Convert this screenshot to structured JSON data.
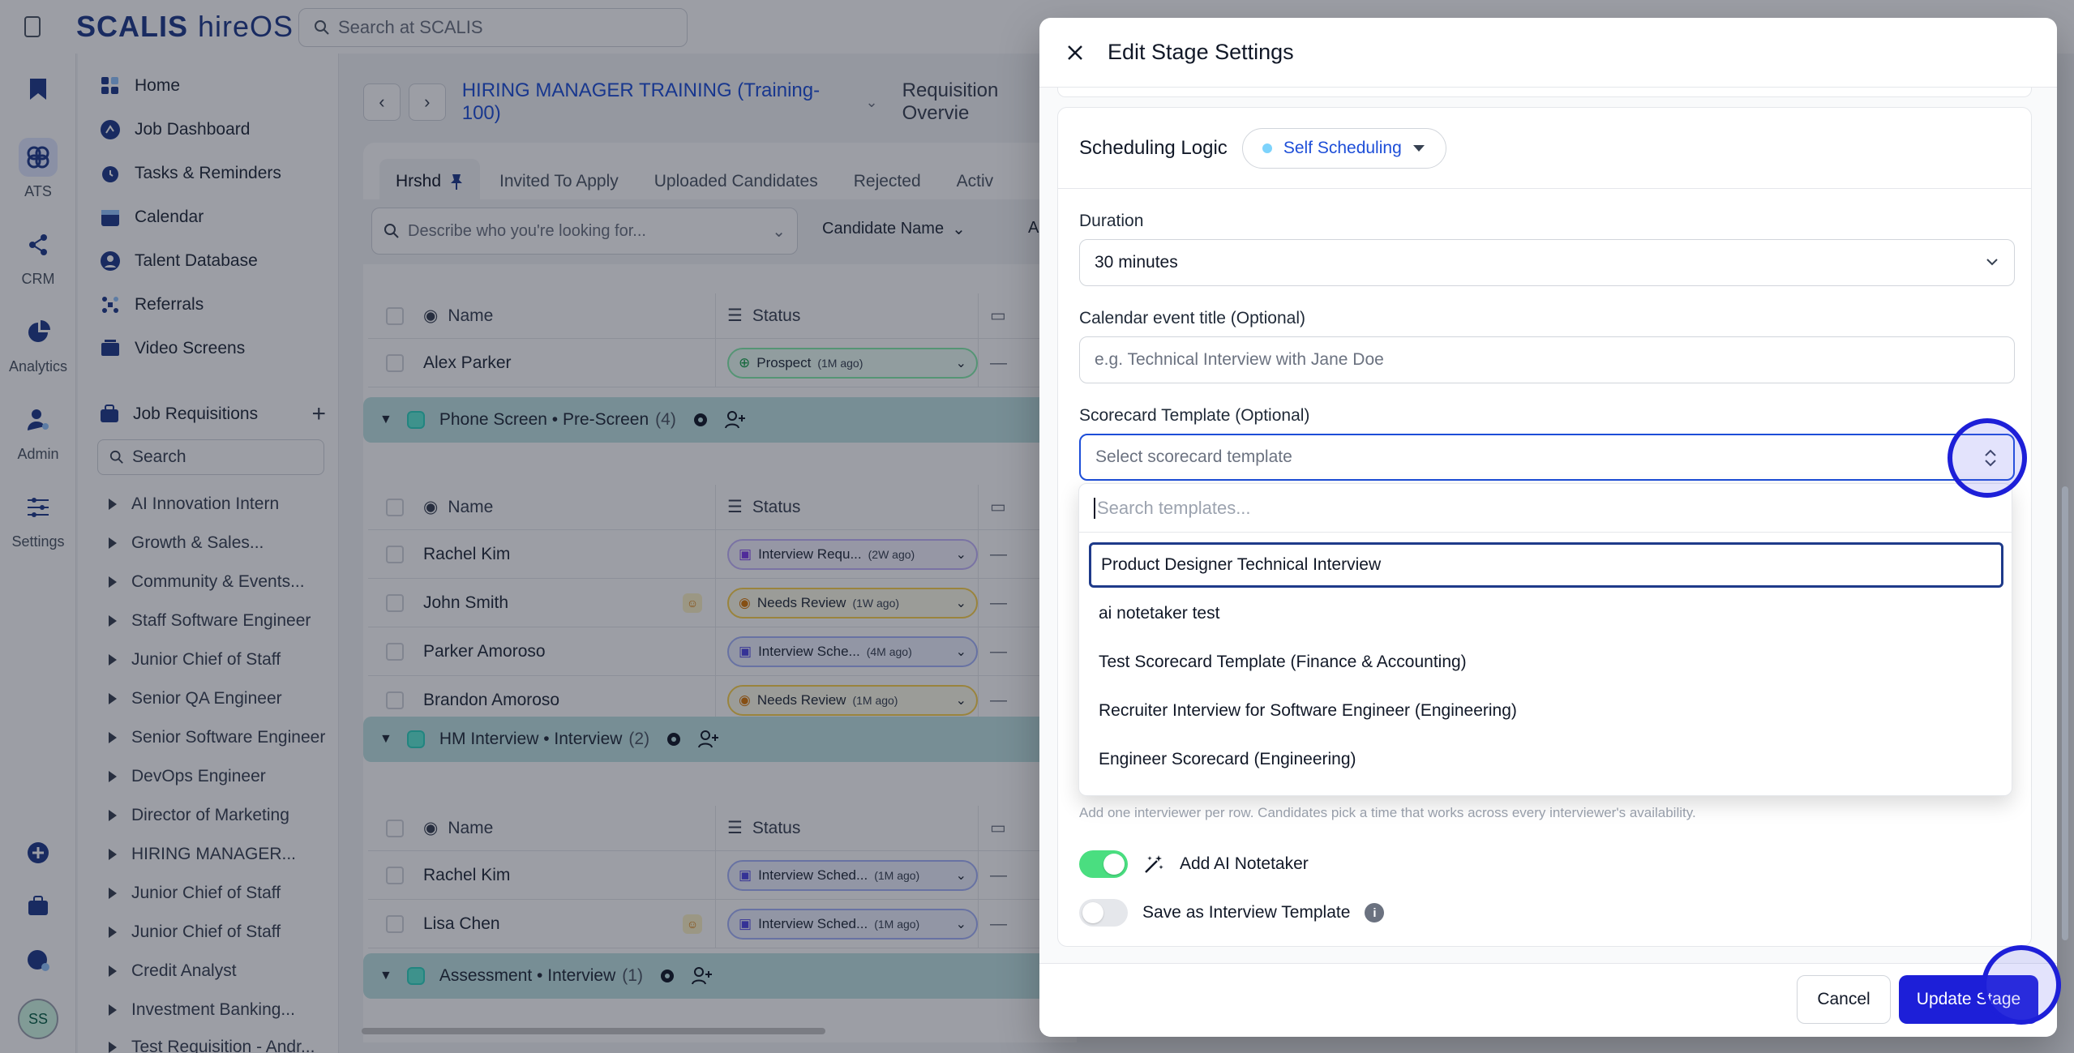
{
  "app": {
    "brand": "SCALIS",
    "product": "hireOS",
    "search_placeholder": "Search at SCALIS"
  },
  "rail": {
    "items": [
      {
        "label": "ATS",
        "icon": "ats-icon"
      },
      {
        "label": "CRM",
        "icon": "crm-icon"
      },
      {
        "label": "Analytics",
        "icon": "analytics-icon"
      },
      {
        "label": "Admin",
        "icon": "admin-icon"
      },
      {
        "label": "Settings",
        "icon": "settings-icon"
      }
    ],
    "avatar_initials": "SS"
  },
  "sidebar": {
    "nav": [
      "Home",
      "Job Dashboard",
      "Tasks & Reminders",
      "Calendar",
      "Talent Database",
      "Referrals",
      "Video Screens"
    ],
    "requisitions_label": "Job Requisitions",
    "search_placeholder": "Search",
    "requisitions": [
      "AI Innovation Intern",
      "Growth & Sales...",
      "Community & Events...",
      "Staff Software Engineer",
      "Junior Chief of Staff",
      "Senior QA Engineer",
      "Senior Software Engineer",
      "DevOps Engineer",
      "Director of Marketing",
      "HIRING MANAGER...",
      "Junior Chief of Staff",
      "Junior Chief of Staff",
      "Credit Analyst",
      "Investment Banking...",
      "Test Requisition - Andr..."
    ]
  },
  "main": {
    "requisition_title": "HIRING MANAGER TRAINING (Training-100)",
    "view_label": "Requisition Overvie",
    "tabs": [
      "Hrshd",
      "Invited To Apply",
      "Uploaded Candidates",
      "Rejected",
      "Activ"
    ],
    "describe_placeholder": "Describe who you're looking for...",
    "filter_candidate_name": "Candidate Name",
    "filter_appl": "Appl",
    "col_name": "Name",
    "col_status": "Status",
    "dash": "—",
    "groups": [
      {
        "title": "Phone Screen • Pre-Screen",
        "count": "(4)"
      },
      {
        "title": "HM Interview • Interview",
        "count": "(2)"
      },
      {
        "title": "Assessment • Interview",
        "count": "(1)"
      }
    ],
    "rows_top": [
      {
        "name": "Alex Parker",
        "status": "Prospect",
        "ago": "(1M ago)"
      }
    ],
    "rows_phone": [
      {
        "name": "Rachel Kim",
        "status": "Interview Requ...",
        "ago": "(2W ago)"
      },
      {
        "name": "John Smith",
        "status": "Needs Review",
        "ago": "(1W ago)"
      },
      {
        "name": "Parker Amoroso",
        "status": "Interview Sche...",
        "ago": "(4M ago)"
      },
      {
        "name": "Brandon Amoroso",
        "status": "Needs Review",
        "ago": "(1M ago)"
      }
    ],
    "rows_hm": [
      {
        "name": "Rachel Kim",
        "status": "Interview Sched...",
        "ago": "(1M ago)"
      },
      {
        "name": "Lisa Chen",
        "status": "Interview Sched...",
        "ago": "(1M ago)"
      }
    ]
  },
  "modal": {
    "title": "Edit Stage Settings",
    "scheduling_logic_label": "Scheduling Logic",
    "scheduling_logic_value": "Self Scheduling",
    "duration_label": "Duration",
    "duration_value": "30 minutes",
    "event_title_label": "Calendar event title (Optional)",
    "event_title_placeholder": "e.g. Technical Interview with Jane Doe",
    "scorecard_label": "Scorecard Template (Optional)",
    "scorecard_placeholder": "Select scorecard template",
    "dropdown_search_placeholder": "Search templates...",
    "options": [
      "Product Designer Technical Interview",
      "ai notetaker test",
      "Test Scorecard Template (Finance & Accounting)",
      "Recruiter Interview for Software Engineer (Engineering)",
      "Engineer Scorecard (Engineering)"
    ],
    "hint_text": "Add one interviewer per row. Candidates pick a time that works across every interviewer's availability.",
    "ai_notetaker_label": "Add AI Notetaker",
    "ai_notetaker_on": true,
    "save_template_label": "Save as Interview Template",
    "save_template_on": false,
    "cancel_label": "Cancel",
    "update_label": "Update Stage"
  },
  "colors": {
    "primary": "#1d1fd8",
    "link": "#1d4ed8",
    "toggle_on": "#4ade80",
    "group_header": "#bfe3e3"
  }
}
